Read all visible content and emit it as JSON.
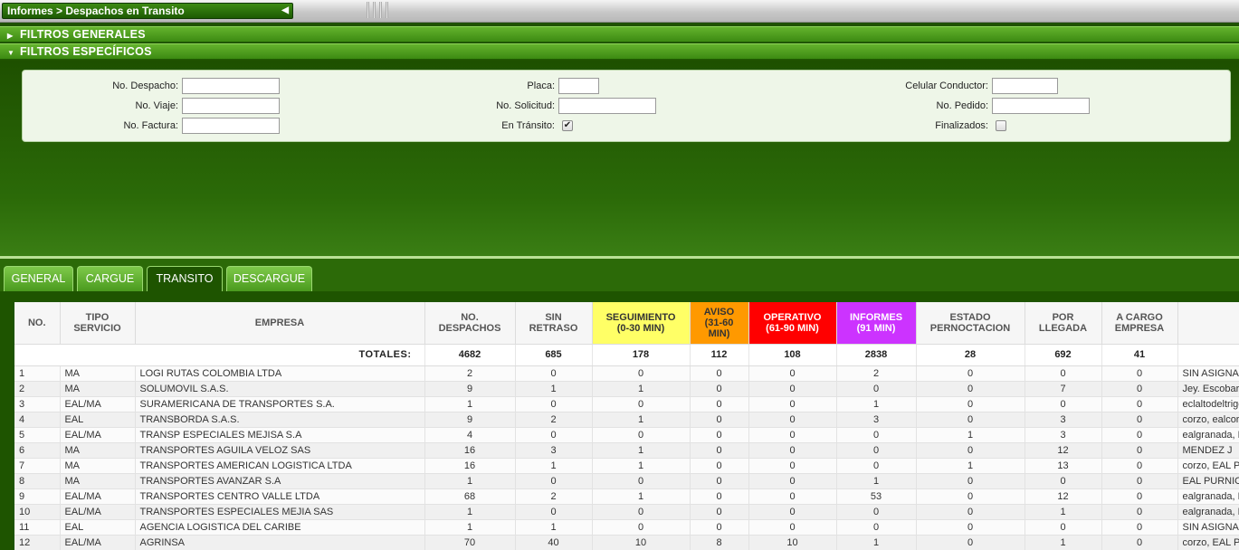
{
  "breadcrumb": "Informes > Despachos en Transito",
  "sections": {
    "general_filters": "FILTROS GENERALES",
    "specific_filters": "FILTROS ESPECÍFICOS"
  },
  "filters": {
    "no_despacho": {
      "label": "No. Despacho:",
      "value": ""
    },
    "no_viaje": {
      "label": "No. Viaje:",
      "value": ""
    },
    "no_factura": {
      "label": "No. Factura:",
      "value": ""
    },
    "placa": {
      "label": "Placa:",
      "value": ""
    },
    "no_solicitud": {
      "label": "No. Solicitud:",
      "value": ""
    },
    "en_transito": {
      "label": "En Tránsito:",
      "checked": true
    },
    "celular_conductor": {
      "label": "Celular Conductor:",
      "value": ""
    },
    "no_pedido": {
      "label": "No. Pedido:",
      "value": ""
    },
    "finalizados": {
      "label": "Finalizados:",
      "checked": false
    }
  },
  "tabs": [
    {
      "label": "GENERAL",
      "active": false
    },
    {
      "label": "CARGUE",
      "active": false
    },
    {
      "label": "TRANSITO",
      "active": true
    },
    {
      "label": "DESCARGUE",
      "active": false
    }
  ],
  "table": {
    "headers": {
      "no": "NO.",
      "tipo_line1": "TIPO",
      "tipo_line2": "SERVICIO",
      "empresa": "EMPRESA",
      "despachos_line1": "NO.",
      "despachos_line2": "DESPACHOS",
      "sin_line1": "SIN",
      "sin_line2": "RETRASO",
      "seg_line1": "SEGUIMIENTO",
      "seg_line2": "(0-30 MIN)",
      "avi_line1": "AVISO",
      "avi_line2": "(31-60",
      "avi_line3": "MIN)",
      "ope_line1": "OPERATIVO",
      "ope_line2": "(61-90 MIN)",
      "inf_line1": "INFORMES",
      "inf_line2": "(91 MIN)",
      "est_line1": "ESTADO",
      "est_line2": "PERNOCTACION",
      "por_line1": "POR",
      "por_line2": "LLEGADA",
      "car_line1": "A CARGO",
      "car_line2": "EMPRESA",
      "last": ""
    },
    "totals": {
      "label": "TOTALES:",
      "despachos": "4682",
      "sin_retraso": "685",
      "seguimiento": "178",
      "aviso": "112",
      "operativo": "108",
      "informes": "2838",
      "pernoctacion": "28",
      "por_llegada": "692",
      "a_cargo": "41"
    },
    "rows": [
      [
        "1",
        "MA",
        "LOGI RUTAS COLOMBIA LTDA",
        "2",
        "0",
        "0",
        "0",
        "0",
        "2",
        "0",
        "0",
        "0",
        "SIN ASIGNAR"
      ],
      [
        "2",
        "MA",
        "SOLUMOVIL S.A.S.",
        "9",
        "1",
        "1",
        "0",
        "0",
        "0",
        "0",
        "7",
        "0",
        "Jey. Escobar"
      ],
      [
        "3",
        "EAL/MA",
        "SURAMERICANA DE TRANSPORTES S.A.",
        "1",
        "0",
        "0",
        "0",
        "0",
        "1",
        "0",
        "0",
        "0",
        "eclaltodeltrigo"
      ],
      [
        "4",
        "EAL",
        "TRANSBORDA S.A.S.",
        "9",
        "2",
        "1",
        "0",
        "0",
        "3",
        "0",
        "3",
        "0",
        "corzo, ealcorzo"
      ],
      [
        "5",
        "EAL/MA",
        "TRANSP ESPECIALES MEJISA S.A",
        "4",
        "0",
        "0",
        "0",
        "0",
        "0",
        "1",
        "3",
        "0",
        "ealgranada, EAL"
      ],
      [
        "6",
        "MA",
        "TRANSPORTES AGUILA VELOZ SAS",
        "16",
        "3",
        "1",
        "0",
        "0",
        "0",
        "0",
        "12",
        "0",
        "MENDEZ J"
      ],
      [
        "7",
        "MA",
        "TRANSPORTES AMERICAN LOGISTICA LTDA",
        "16",
        "1",
        "1",
        "0",
        "0",
        "0",
        "1",
        "13",
        "0",
        "corzo, EAL PURN"
      ],
      [
        "8",
        "MA",
        "TRANSPORTES AVANZAR S.A",
        "1",
        "0",
        "0",
        "0",
        "0",
        "1",
        "0",
        "0",
        "0",
        "EAL PURNIO"
      ],
      [
        "9",
        "EAL/MA",
        "TRANSPORTES CENTRO VALLE LTDA",
        "68",
        "2",
        "1",
        "0",
        "0",
        "53",
        "0",
        "12",
        "0",
        "ealgranada, EAL"
      ],
      [
        "10",
        "EAL/MA",
        "TRANSPORTES ESPECIALES MEJIA SAS",
        "1",
        "0",
        "0",
        "0",
        "0",
        "0",
        "0",
        "1",
        "0",
        "ealgranada, EAL"
      ],
      [
        "11",
        "EAL",
        "AGENCIA LOGISTICA DEL CARIBE",
        "1",
        "1",
        "0",
        "0",
        "0",
        "0",
        "0",
        "0",
        "0",
        "SIN ASIGNAR"
      ],
      [
        "12",
        "EAL/MA",
        "AGRINSA",
        "70",
        "40",
        "10",
        "8",
        "10",
        "1",
        "0",
        "1",
        "0",
        "corzo, EAL PURN"
      ]
    ]
  }
}
